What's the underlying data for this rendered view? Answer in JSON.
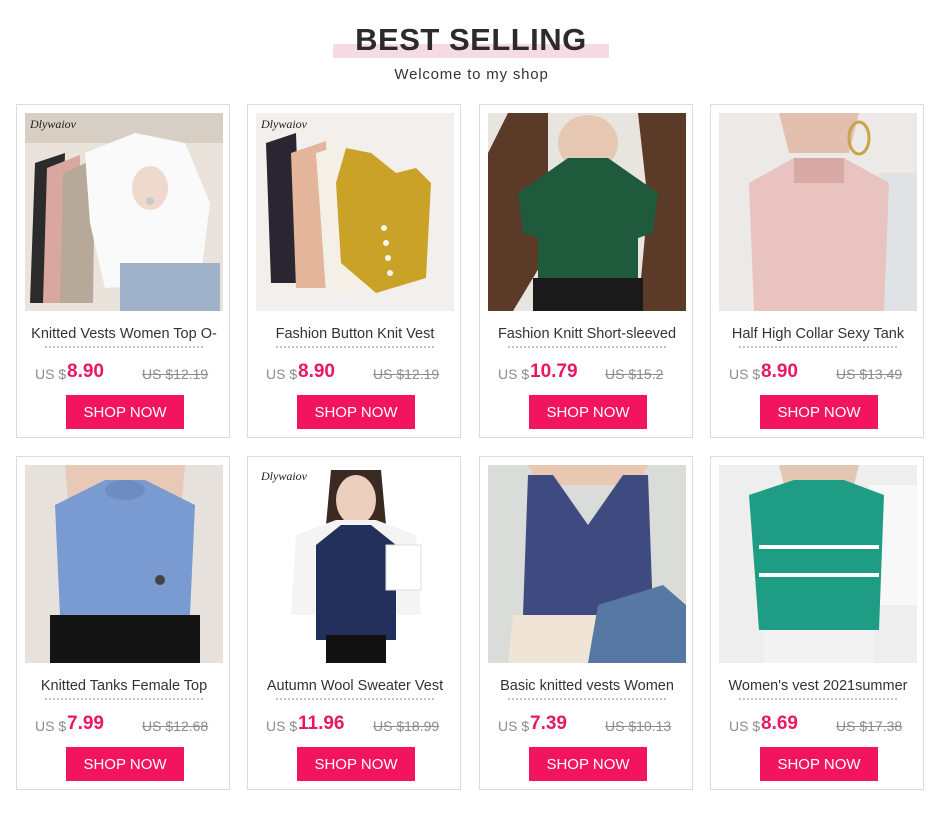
{
  "header": {
    "title": "BEST SELLING",
    "subtitle": "Welcome to my shop"
  },
  "colors": {
    "accent": "#f2145e",
    "price": "#ea1762",
    "title_highlight": "#f6dbe6"
  },
  "products": [
    {
      "name": "Knitted Vests Women Top O-",
      "currency": "US $",
      "price": "8.90",
      "old_price": "US $12.19",
      "button": "SHOP NOW",
      "brand": "Dlywaiov"
    },
    {
      "name": "Fashion Button Knit Vest",
      "currency": "US $",
      "price": "8.90",
      "old_price": "US $12.19",
      "button": "SHOP NOW",
      "brand": "Dlywaiov"
    },
    {
      "name": "Fashion Knitt Short-sleeved",
      "currency": "US $",
      "price": "10.79",
      "old_price": "US $15.2",
      "button": "SHOP NOW",
      "brand": ""
    },
    {
      "name": "Half High Collar Sexy Tank",
      "currency": "US $",
      "price": "8.90",
      "old_price": "US $13.49",
      "button": "SHOP NOW",
      "brand": ""
    },
    {
      "name": "Knitted Tanks Female Top",
      "currency": "US $",
      "price": "7.99",
      "old_price": "US $12.68",
      "button": "SHOP NOW",
      "brand": ""
    },
    {
      "name": "Autumn Wool Sweater Vest",
      "currency": "US $",
      "price": "11.96",
      "old_price": "US $18.99",
      "button": "SHOP NOW",
      "brand": "Dlywaiov"
    },
    {
      "name": "Basic knitted vests Women",
      "currency": "US $",
      "price": "7.39",
      "old_price": "US $10.13",
      "button": "SHOP NOW",
      "brand": ""
    },
    {
      "name": "Women's vest 2021summer",
      "currency": "US $",
      "price": "8.69",
      "old_price": "US $17.38",
      "button": "SHOP NOW",
      "brand": ""
    }
  ]
}
